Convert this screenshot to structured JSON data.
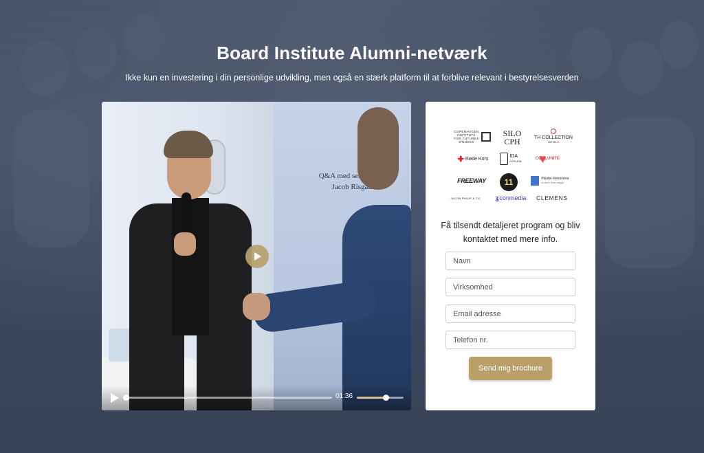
{
  "header": {
    "title": "Board Institute Alumni-netværk",
    "subtitle": "Ikke kun en investering i din personlige udvikling, men også en stærk platform til at forblive relevant i bestyrelsesverden"
  },
  "video": {
    "screen_text_line1": "Q&A med serieinvestor",
    "screen_text_line2": "Jacob Risgaard",
    "time": "01:36",
    "progress": 0.0,
    "volume": 0.62,
    "play_icon": "play-icon"
  },
  "logos": {
    "copenhagen": [
      "COPENHAGEN",
      "INSTITUTE",
      "FOR FUTURES",
      "STUDIES"
    ],
    "silo": [
      "SILO",
      "CPH"
    ],
    "th": [
      "TH COLLECTION",
      "HOTELS"
    ],
    "rode_kors": "Røde Kors",
    "ida": [
      "IDA",
      "DYRLEIN"
    ],
    "coolunite": "COOLUNITE",
    "freeway": "FREEWAY",
    "eleven": "11",
    "plaster": [
      "Plaster Renoverre",
      "ny æra i flotte vægge"
    ],
    "jacob": "JACOB PHILIP & CO",
    "conmedia": "conmedia",
    "clemens": "CLEMENS"
  },
  "form": {
    "heading": "Få tilsendt detaljeret program og bliv kontaktet med mere info.",
    "name_placeholder": "Navn",
    "company_placeholder": "Virksomhed",
    "email_placeholder": "Email adresse",
    "phone_placeholder": "Telefon nr.",
    "submit_label": "Send mig brochure"
  },
  "colors": {
    "accent": "#b9a06a",
    "overlay": "#3e4a5e"
  }
}
